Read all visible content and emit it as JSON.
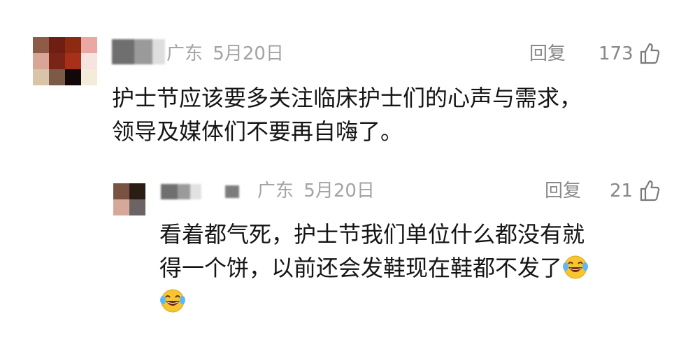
{
  "comment": {
    "location": "广东",
    "date": "5月20日",
    "reply_label": "回复",
    "like_count": "173",
    "text_lines": [
      "护士节应该要多关注临床护士们的心声与需求，",
      "领导及媒体们不要再自嗨了。"
    ]
  },
  "reply": {
    "location": "广东",
    "date": "5月20日",
    "reply_label": "回复",
    "like_count": "21",
    "text_lines": [
      "看着都气死，护士节我们单位什么都没有就",
      "得一个饼，以前还会发鞋现在鞋都不发了"
    ],
    "emoji_name": "laughing-crying-emoji"
  },
  "colors": {
    "meta_gray": "#a3a3a3",
    "action_gray": "#888888",
    "text": "#151515",
    "emoji_yellow": "#f7c531"
  }
}
